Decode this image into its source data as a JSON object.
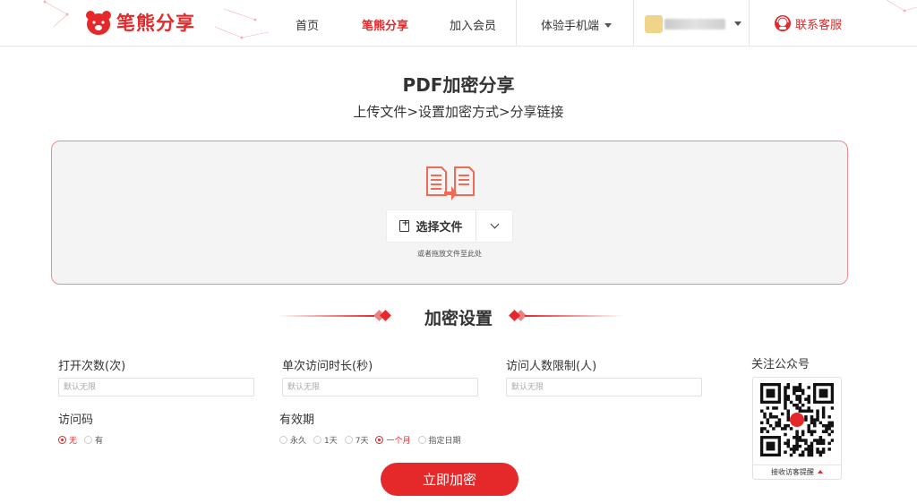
{
  "brand": {
    "name": "笔熊分享",
    "color": "#e5282a"
  },
  "nav": {
    "items": [
      "首页",
      "笔熊分享",
      "加入会员",
      "体验手机端"
    ],
    "active": "笔熊分享",
    "service": "联系客服"
  },
  "page": {
    "title": "PDF加密分享",
    "steps": "上传文件>设置加密方式>分享链接"
  },
  "upload": {
    "choose_label": "选择文件",
    "drag_hint": "或者拖放文件至此处"
  },
  "settings": {
    "heading": "加密设置",
    "open_count_label": "打开次数(次)",
    "open_count_placeholder": "默认无限",
    "duration_label": "单次访问时长(秒)",
    "duration_placeholder": "默认无限",
    "visitor_limit_label": "访问人数限制(人)",
    "visitor_limit_placeholder": "默认无限",
    "access_code_label": "访问码",
    "access_code_options": [
      "无",
      "有"
    ],
    "access_code_selected": "无",
    "validity_label": "有效期",
    "validity_options": [
      "永久",
      "1天",
      "7天",
      "一个月",
      "指定日期"
    ],
    "validity_selected": "一个月",
    "submit_label": "立即加密"
  },
  "qr": {
    "title": "关注公众号",
    "footer": "接收访客提醒"
  }
}
